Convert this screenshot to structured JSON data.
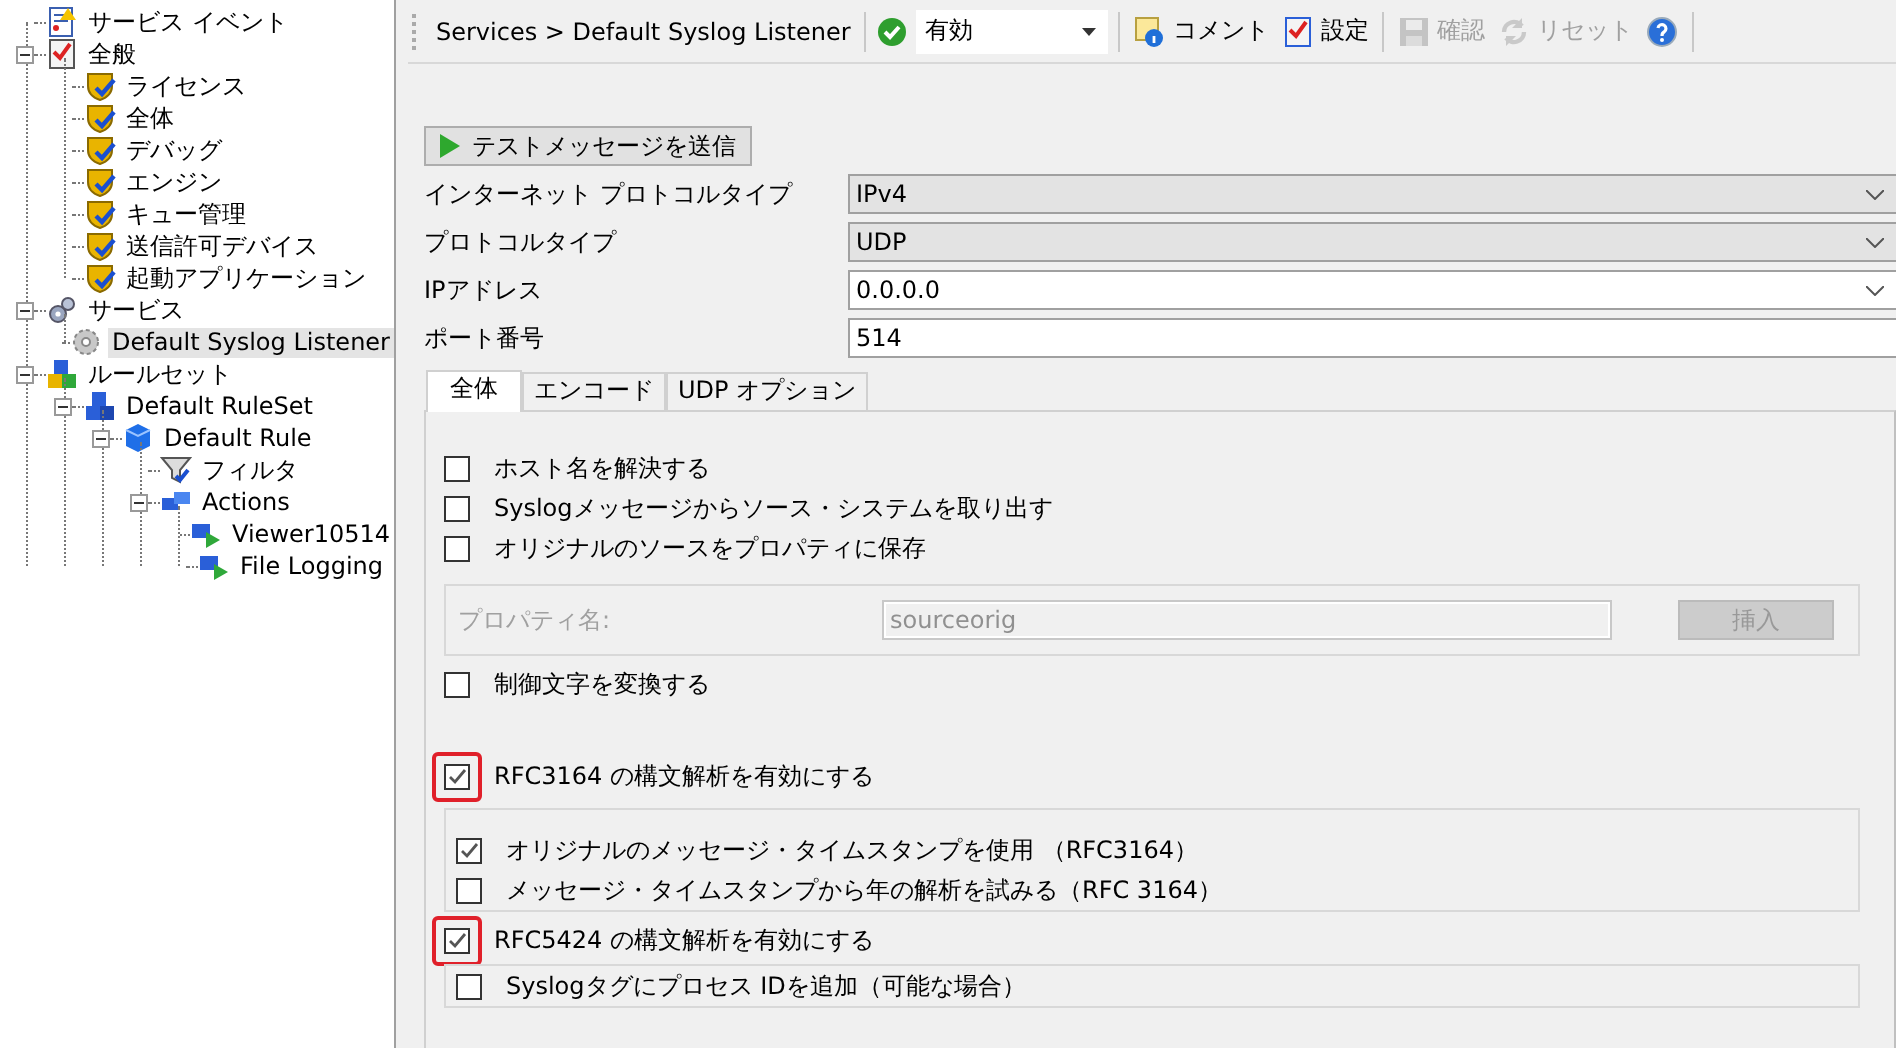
{
  "tree": [
    {
      "label": "サービス イベント",
      "kind": "event",
      "selected": false
    },
    {
      "label": "全般",
      "kind": "general",
      "selected": false,
      "expanded": true,
      "children": [
        {
          "label": "ライセンス",
          "kind": "setting",
          "selected": false
        },
        {
          "label": "全体",
          "kind": "setting",
          "selected": false
        },
        {
          "label": "デバッグ",
          "kind": "setting",
          "selected": false
        },
        {
          "label": "エンジン",
          "kind": "setting",
          "selected": false
        },
        {
          "label": "キュー管理",
          "kind": "setting",
          "selected": false
        },
        {
          "label": "送信許可デバイス",
          "kind": "setting",
          "selected": false
        },
        {
          "label": "起動アプリケーション",
          "kind": "setting",
          "selected": false
        }
      ]
    },
    {
      "label": "サービス",
      "kind": "services",
      "selected": false,
      "expanded": true,
      "children": [
        {
          "label": "Default Syslog Listener",
          "kind": "service",
          "selected": true
        }
      ]
    },
    {
      "label": "ルールセット",
      "kind": "rulesets",
      "selected": false,
      "expanded": true,
      "children": [
        {
          "label": "Default RuleSet",
          "kind": "ruleset",
          "selected": false,
          "expanded": true,
          "children": [
            {
              "label": "Default Rule",
              "kind": "rule",
              "selected": false,
              "expanded": true,
              "children": [
                {
                  "label": "フィルタ",
                  "kind": "filter",
                  "selected": false
                },
                {
                  "label": "Actions",
                  "kind": "actions",
                  "selected": false,
                  "expanded": true,
                  "children": [
                    {
                      "label": "Viewer10514",
                      "kind": "action",
                      "selected": false
                    },
                    {
                      "label": "File Logging",
                      "kind": "action",
                      "selected": false
                    }
                  ]
                }
              ]
            }
          ]
        }
      ]
    }
  ],
  "toolbar": {
    "breadcrumb": "Services > Default Syslog Listener",
    "status": "有効",
    "groups": [
      [
        {
          "label": "コメント",
          "kind": "comment",
          "disabled": false
        },
        {
          "label": "設定",
          "kind": "settings",
          "disabled": false
        }
      ],
      [
        {
          "label": "確認",
          "kind": "save",
          "disabled": true
        },
        {
          "label": "リセット",
          "kind": "reset",
          "disabled": true
        },
        {
          "kind": "help",
          "disabled": false
        }
      ]
    ]
  },
  "send_button": "テストメッセージを送信",
  "fields": [
    {
      "label": "インターネット プロトコルタイプ",
      "value": "IPv4",
      "kind": "select",
      "disabled": true
    },
    {
      "label": "プロトコルタイプ",
      "value": "UDP",
      "kind": "select",
      "disabled": true
    },
    {
      "label": "IPアドレス",
      "value": "0.0.0.0",
      "kind": "select",
      "disabled": false
    },
    {
      "label": "ポート番号",
      "value": "514",
      "kind": "text",
      "disabled": false
    }
  ],
  "tabs": [
    {
      "label": "全体",
      "selected": true
    },
    {
      "label": "エンコード",
      "selected": false
    },
    {
      "label": "UDP オプション",
      "selected": false
    }
  ],
  "options": [
    {
      "kind": "checkbox",
      "label": "ホスト名を解決する",
      "checked": false
    },
    {
      "kind": "checkbox",
      "label": "Syslogメッセージからソース・システムを取り出す",
      "checked": false
    },
    {
      "kind": "checkbox",
      "label": "オリジナルのソースをプロパティに保存",
      "checked": false
    },
    {
      "kind": "property",
      "label": "プロパティ名:",
      "value": "sourceorig",
      "button": "挿入",
      "disabled": true
    },
    {
      "kind": "checkbox",
      "label": "制御文字を変換する",
      "checked": false
    },
    {
      "kind": "checkbox",
      "label": "RFC3164 の構文解析を有効にする",
      "checked": true,
      "highlighted": true,
      "children": [
        {
          "kind": "checkbox",
          "label": "オリジナルのメッセージ・タイムスタンプを使用 （RFC3164）",
          "checked": true
        },
        {
          "kind": "checkbox",
          "label": "メッセージ・タイムスタンプから年の解析を試みる（RFC 3164）",
          "checked": false
        }
      ]
    },
    {
      "kind": "checkbox",
      "label": "RFC5424 の構文解析を有効にする",
      "checked": true,
      "highlighted": true,
      "children": [
        {
          "kind": "checkbox",
          "label": "Syslogタグにプロセス IDを追加（可能な場合）",
          "checked": false
        }
      ]
    }
  ]
}
